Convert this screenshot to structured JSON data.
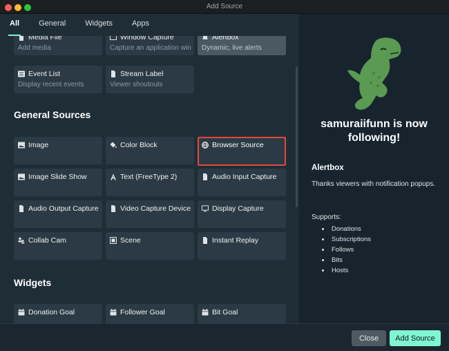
{
  "window": {
    "title": "Add Source"
  },
  "tabs": [
    {
      "label": "All",
      "active": true
    },
    {
      "label": "General",
      "active": false
    },
    {
      "label": "Widgets",
      "active": false
    },
    {
      "label": "Apps",
      "active": false
    }
  ],
  "top_tiles": [
    {
      "title": "Media File",
      "desc": "Add media",
      "icon": "file-icon"
    },
    {
      "title": "Window Capture",
      "desc": "Capture an application window",
      "icon": "window-icon"
    },
    {
      "title": "Alertbox",
      "desc": "Dynamic, live alerts",
      "icon": "bell-icon"
    },
    {
      "title": "Event List",
      "desc": "Display recent events",
      "icon": "list-icon"
    },
    {
      "title": "Stream Label",
      "desc": "Viewer shoutouts",
      "icon": "file-icon"
    }
  ],
  "sections": {
    "general": "General Sources",
    "widgets": "Widgets"
  },
  "general_tiles": [
    {
      "title": "Image",
      "icon": "image-icon"
    },
    {
      "title": "Color Block",
      "icon": "paint-bucket-icon"
    },
    {
      "title": "Browser Source",
      "icon": "globe-icon",
      "selected": true
    },
    {
      "title": "Image Slide Show",
      "icon": "image-icon"
    },
    {
      "title": "Text (FreeType 2)",
      "icon": "text-icon"
    },
    {
      "title": "Audio Input Capture",
      "icon": "file-icon"
    },
    {
      "title": "Audio Output Capture",
      "icon": "file-icon"
    },
    {
      "title": "Video Capture Device",
      "icon": "file-icon"
    },
    {
      "title": "Display Capture",
      "icon": "monitor-icon"
    },
    {
      "title": "Collab Cam",
      "icon": "people-icon"
    },
    {
      "title": "Scene",
      "icon": "scene-icon"
    },
    {
      "title": "Instant Replay",
      "icon": "file-icon"
    }
  ],
  "widget_tiles": [
    {
      "title": "Donation Goal",
      "icon": "calendar-icon"
    },
    {
      "title": "Follower Goal",
      "icon": "calendar-icon"
    },
    {
      "title": "Bit Goal",
      "icon": "calendar-icon"
    }
  ],
  "preview": {
    "alert_text": "samuraiifunn is now following!",
    "heading": "Alertbox",
    "description": "Thanks viewers with notification popups.",
    "supports_label": "Supports:",
    "supports": [
      "Donations",
      "Subscriptions",
      "Follows",
      "Bits",
      "Hosts"
    ],
    "dino_color": "#5a9a52"
  },
  "footer": {
    "close_label": "Close",
    "add_label": "Add Source"
  },
  "colors": {
    "accent": "#80f5d2",
    "highlight": "#e34a3a",
    "tile": "#2b3a44"
  }
}
